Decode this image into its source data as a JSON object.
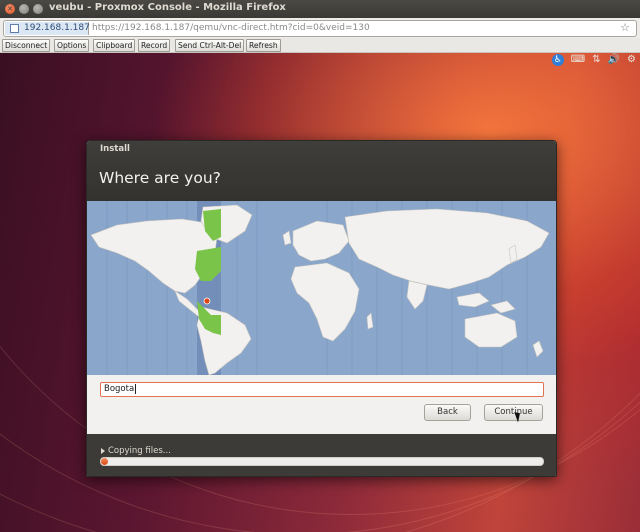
{
  "window": {
    "title": "veubu - Proxmox Console - Mozilla Firefox"
  },
  "urlbar": {
    "site_host": "192.168.1.187",
    "url": "https://192.168.1.187/qemu/vnc-direct.htm?cid=0&veid=130"
  },
  "vnc_toolbar": {
    "buttons": [
      "Disconnect",
      "Options",
      "Clipboard",
      "Record",
      "Send Ctrl-Alt-Del",
      "Refresh"
    ]
  },
  "panel": {
    "icons": [
      "accessibility-icon",
      "keyboard-icon",
      "network-icon",
      "volume-icon",
      "settings-gear-icon"
    ]
  },
  "installer": {
    "window_title": "Install",
    "heading": "Where are you?",
    "location_value": "Bogota",
    "back_label": "Back",
    "continue_label": "Continue",
    "progress_label": "Copying files...",
    "progress_fraction": 0.01,
    "accent_color": "#dd4814",
    "selected_zone_color": "#7bc44a",
    "sea_color": "#8aa6cb",
    "land_color": "#f2f1ef"
  }
}
